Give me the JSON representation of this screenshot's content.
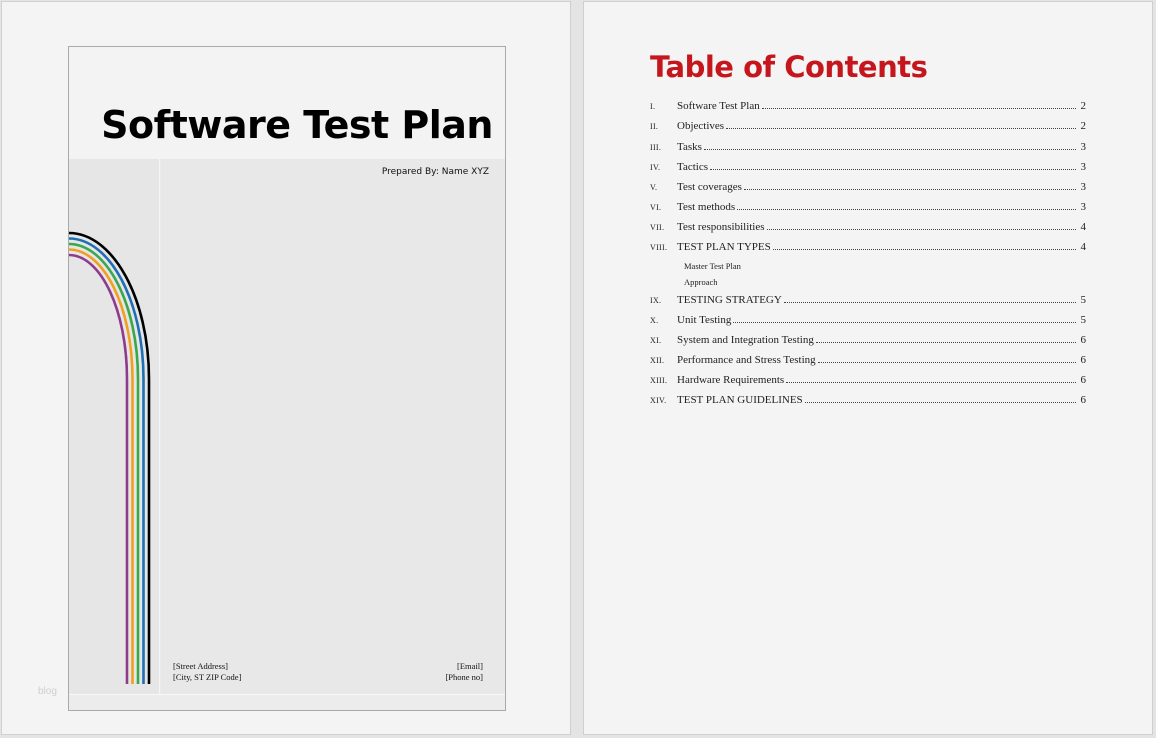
{
  "cover": {
    "title": "Software Test Plan",
    "prepared_by": "Prepared By: Name XYZ",
    "street": "[Street Address]",
    "city": "[City, ST ZIP Code]",
    "email": "[Email]",
    "phone": "[Phone no]",
    "watermark": "blog",
    "stripe_colors": [
      "#000000",
      "#1f6fb5",
      "#3aa84a",
      "#f0a020",
      "#8e3a8e"
    ]
  },
  "toc": {
    "heading": "Table of Contents",
    "items": [
      {
        "num": "I.",
        "text": "Software Test Plan",
        "page": "2"
      },
      {
        "num": "II.",
        "text": "Objectives",
        "page": "2"
      },
      {
        "num": "III.",
        "text": "Tasks",
        "page": "3"
      },
      {
        "num": "IV.",
        "text": "Tactics",
        "page": "3"
      },
      {
        "num": "V.",
        "text": "Test coverages",
        "page": "3"
      },
      {
        "num": "VI.",
        "text": "Test methods",
        "page": "3"
      },
      {
        "num": "VII.",
        "text": "Test responsibilities",
        "page": "4"
      },
      {
        "num": "VIII.",
        "text": "TEST PLAN TYPES",
        "page": "4"
      },
      {
        "num": "IX.",
        "text": "TESTING STRATEGY",
        "page": "5"
      },
      {
        "num": "X.",
        "text": "Unit Testing",
        "page": "5"
      },
      {
        "num": "XI.",
        "text": "System and Integration Testing",
        "page": "6"
      },
      {
        "num": "XII.",
        "text": "Performance and Stress Testing",
        "page": "6"
      },
      {
        "num": "XIII.",
        "text": "Hardware Requirements",
        "page": "6"
      },
      {
        "num": "XIV.",
        "text": "TEST PLAN GUIDELINES",
        "page": "6"
      }
    ],
    "subitems": [
      "Master Test Plan",
      "Approach"
    ]
  }
}
